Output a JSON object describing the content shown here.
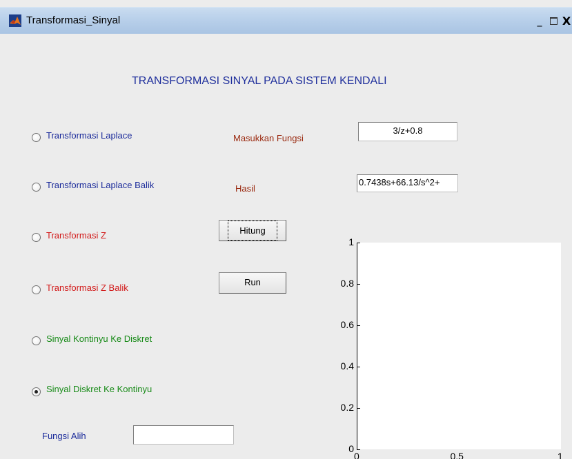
{
  "window": {
    "title": "Transformasi_Sinyal",
    "minimize": "_",
    "close": "X"
  },
  "main_title": "TRANSFORMASI SINYAL PADA SISTEM KENDALI",
  "options": [
    {
      "label": "Transformasi Laplace",
      "color": "#1a2a9a",
      "selected": false
    },
    {
      "label": "Transformasi Laplace Balik",
      "color": "#1a2a9a",
      "selected": false
    },
    {
      "label": "Transformasi Z",
      "color": "#d21a1a",
      "selected": false
    },
    {
      "label": "Transformasi Z Balik",
      "color": "#d21a1a",
      "selected": false
    },
    {
      "label": "Sinyal Kontinyu Ke Diskret",
      "color": "#178a17",
      "selected": false
    },
    {
      "label": "Sinyal Diskret Ke Kontinyu",
      "color": "#178a17",
      "selected": true
    }
  ],
  "input": {
    "label": "Masukkan Fungsi",
    "value": "3/z+0.8"
  },
  "result": {
    "label": "Hasil",
    "value": "0.7438s+66.13/s^2+"
  },
  "buttons": {
    "hitung": "Hitung",
    "run": "Run"
  },
  "transfer": {
    "label": "Fungsi Alih",
    "value": ""
  },
  "chart_data": {
    "type": "line",
    "title": "",
    "xlabel": "",
    "ylabel": "",
    "xlim": [
      0,
      1
    ],
    "ylim": [
      0,
      1
    ],
    "series": [],
    "y_ticks": [
      "0",
      "0.2",
      "0.4",
      "0.6",
      "0.8",
      "1"
    ],
    "x_ticks": [
      "0",
      "0.5",
      "1"
    ],
    "grid": false
  }
}
